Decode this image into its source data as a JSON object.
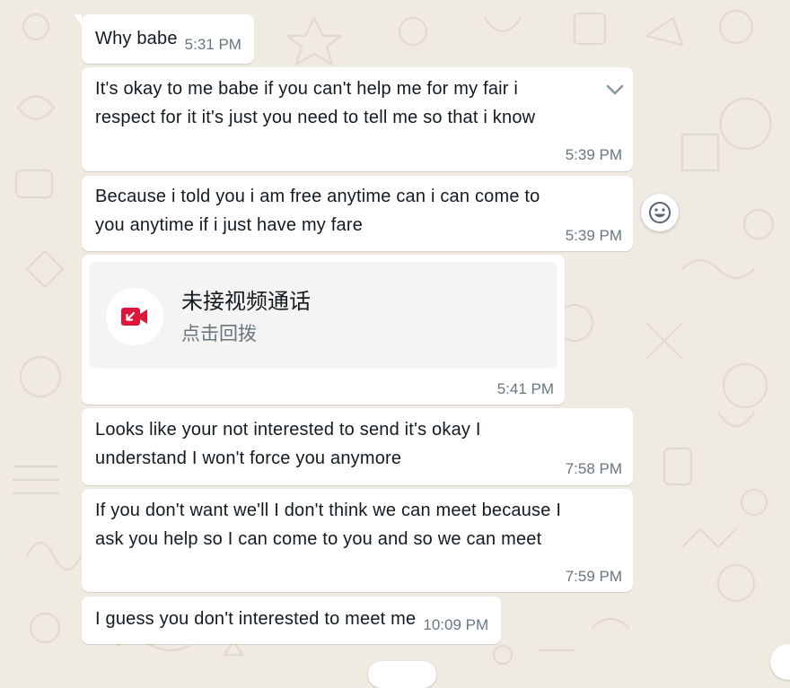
{
  "colors": {
    "wallpaper": "#efeae2",
    "bubble": "#ffffff",
    "timestamp": "#667781",
    "missed_call_red": "#e0153c",
    "call_card": "#f5f4f2"
  },
  "messages": [
    {
      "text": "Why babe",
      "time": "5:31 PM"
    },
    {
      "lines": [
        "It's okay to me babe if you can't help me for my fair i",
        "respect for it it's just you need to tell me so that i know"
      ],
      "time": "5:39 PM",
      "menu_icon": "chevron-down-icon"
    },
    {
      "lines": [
        "Because i told you i am free anytime can i can come to",
        "you anytime if i just have my fare"
      ],
      "time": "5:39 PM",
      "reaction_icon": "smiley-icon"
    },
    {
      "call": {
        "title": "未接视频通话",
        "subtitle": "点击回拨",
        "icon": "missed-video-call-icon"
      },
      "time": "5:41 PM"
    },
    {
      "lines": [
        "Looks like your not interested to send it's okay I",
        "understand I won't force you anymore"
      ],
      "time": "7:58 PM"
    },
    {
      "lines": [
        "If you don't want we'll I don't think we can meet because I",
        "ask you help so I can come to you and so we can meet"
      ],
      "time": "7:59 PM"
    },
    {
      "text": "I guess you don't interested to meet me",
      "time": "10:09 PM"
    }
  ]
}
